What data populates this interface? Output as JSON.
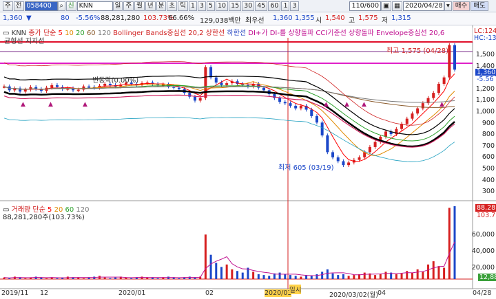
{
  "toolbar": {
    "period_btn": "주",
    "prev_btn": "전",
    "code": "058400",
    "trade_btn": "신",
    "name": "KNN",
    "period_tabs": [
      "일",
      "주",
      "월",
      "년",
      "분",
      "초",
      "틱"
    ],
    "intervals": [
      "1",
      "3",
      "5",
      "10",
      "15",
      "30",
      "45",
      "60",
      "1",
      "3"
    ],
    "count": "110/600",
    "date": "2020/04/28",
    "buy_btn": "매수",
    "sell_btn": "매도"
  },
  "quote": {
    "price": "1,360",
    "change": "80",
    "change_pct": "-5.56%",
    "volume": "88,281,280",
    "vol_ratio": "103.73%",
    "turnover": "66.66%",
    "amount": "129,038백만",
    "pref_label": "최우선",
    "ask": "1,360",
    "bid": "1,355",
    "open_label": "시",
    "open": "1,540",
    "high_label": "고",
    "high": "1,575",
    "low_label": "저",
    "low": "1,315",
    "colors": {
      "up": "#d61f1f",
      "down": "#1b47c9"
    }
  },
  "legend_price": {
    "ticker": "KNN",
    "close_label": "종가 단순",
    "ma_periods": [
      "5",
      "10",
      "20",
      "60",
      "120"
    ],
    "ma_colors": [
      "#ff0000",
      "#e08a00",
      "#2aa02a",
      "#8a5a2b",
      "#7a7a7a"
    ],
    "bollinger": "Bollinger Bands중심선 20,2",
    "upper": "상한선",
    "lower": "하한선",
    "dmi": "DI+가 DI-를 상향돌파",
    "cci": "CCI기준선 상향돌파",
    "envelope": "Envelope중심선 20,6",
    "line2a": "균형선",
    "line2b": "지지선"
  },
  "price_axis": [
    "1,500",
    "1,400",
    "1,300",
    "1,200",
    "1,100",
    "1,000",
    "900",
    "800",
    "700",
    "600",
    "500",
    "400",
    "300"
  ],
  "price_tags": {
    "lc": "LC:124",
    "hc": "HC:-13",
    "last": "1,360",
    "pct": "-5.56"
  },
  "annotations": {
    "high": "최고 1,575 (04/28)",
    "low": "최저 605 (03/19)",
    "mid": "변동락(0.00%)"
  },
  "legend_volume": {
    "label": "거래량 단순",
    "periods": [
      "5",
      "20",
      "60",
      "120"
    ],
    "value": "88,281,280주(103.73%)"
  },
  "volume_axis": [
    "60,000",
    "40,000",
    "20,000"
  ],
  "volume_tags": {
    "top": "88,281",
    "pct": "103.73",
    "mid": "12,88"
  },
  "x_axis": [
    "2019/11",
    "12",
    "2020/01",
    "02",
    "2020/03",
    "2020/03/02(월)",
    "04",
    "04/28"
  ],
  "cursor_label": "일시",
  "chart_data": {
    "type": "candlestick",
    "ylim": [
      300,
      1600
    ],
    "closes": [
      1230,
      1200,
      1215,
      1190,
      1205,
      1225,
      1210,
      1195,
      1220,
      1240,
      1225,
      1210,
      1215,
      1200,
      1205,
      1230,
      1225,
      1220,
      1235,
      1250,
      1240,
      1230,
      1245,
      1260,
      1250,
      1240,
      1255,
      1260,
      1250,
      1240,
      1245,
      1230,
      1220,
      1210,
      1180,
      1150,
      1120,
      1140,
      1380,
      1300,
      1260,
      1240,
      1255,
      1270,
      1250,
      1240,
      1230,
      1250,
      1220,
      1200,
      1170,
      1140,
      1110,
      1100,
      1080,
      1060,
      1080,
      1050,
      1000,
      950,
      850,
      720,
      680,
      650,
      620,
      640,
      660,
      680,
      720,
      760,
      800,
      840,
      880,
      860,
      900,
      940,
      980,
      1020,
      1060,
      1100,
      1140,
      1180,
      1250,
      1300,
      1550,
      1360
    ],
    "highs_note": "",
    "volumes": [
      2,
      1,
      3,
      2,
      1,
      2,
      3,
      2,
      1,
      2,
      1,
      2,
      3,
      2,
      2,
      1,
      2,
      3,
      4,
      2,
      1,
      2,
      3,
      2,
      1,
      2,
      3,
      2,
      2,
      1,
      2,
      3,
      2,
      1,
      2,
      3,
      2,
      3,
      55,
      30,
      20,
      15,
      18,
      12,
      10,
      8,
      14,
      9,
      6,
      5,
      4,
      7,
      8,
      6,
      5,
      4,
      3,
      5,
      4,
      6,
      9,
      12,
      7,
      5,
      6,
      4,
      5,
      6,
      8,
      7,
      5,
      6,
      9,
      8,
      6,
      7,
      10,
      8,
      12,
      9,
      18,
      22,
      16,
      14,
      88,
      90
    ]
  }
}
